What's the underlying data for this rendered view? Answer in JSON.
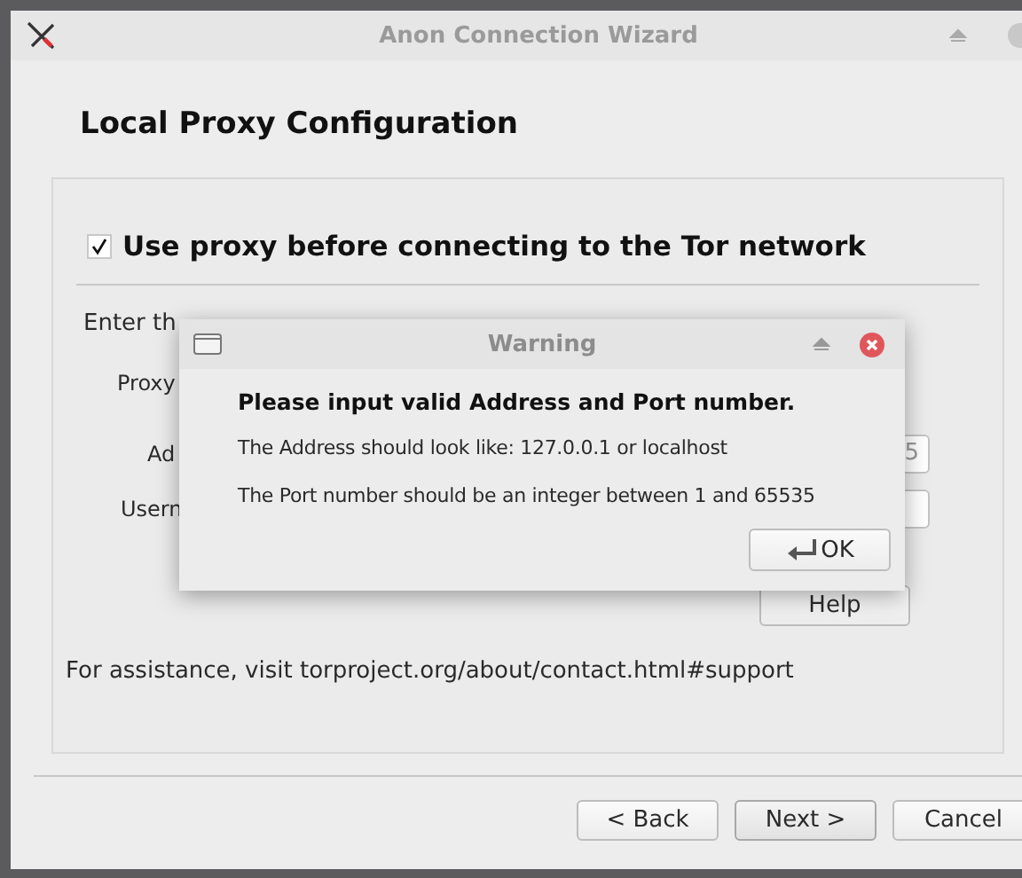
{
  "window": {
    "title": "Anon Connection Wizard"
  },
  "heading": "Local Proxy Configuration",
  "proxy_checkbox": {
    "label": "Use proxy before connecting to the Tor network",
    "checked": true
  },
  "form": {
    "intro": "Enter th",
    "labels": [
      "Proxy",
      "Ad",
      "Usern"
    ],
    "port_value": "5"
  },
  "help_button": {
    "label": "Help"
  },
  "assistance": "For assistance, visit torproject.org/about/contact.html#support",
  "buttons": [
    {
      "label": "< Back",
      "default": false
    },
    {
      "label": "Next >",
      "default": true
    },
    {
      "label": "Cancel",
      "default": false
    }
  ],
  "dialog": {
    "title": "Warning",
    "heading": "Please input valid Address and Port number.",
    "lines": [
      "The Address should look like: 127.0.0.1 or localhost",
      "The Port number should be an integer between 1 and 65535"
    ],
    "ok_button": "OK"
  }
}
